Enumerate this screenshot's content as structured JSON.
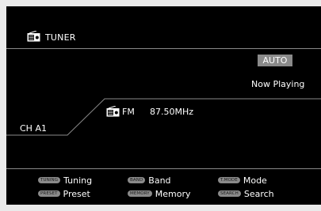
{
  "header": {
    "title": "TUNER",
    "icon": "radio-icon"
  },
  "status": {
    "mode_badge": "AUTO",
    "now_playing": "Now Playing"
  },
  "station": {
    "channel": "CH A1",
    "band": "FM",
    "frequency": "87.50MHz",
    "icon": "radio-icon"
  },
  "legend": [
    {
      "key": "TUNING",
      "label": "Tuning"
    },
    {
      "key": "BAND",
      "label": "Band"
    },
    {
      "key": "T.MODE",
      "label": "Mode"
    },
    {
      "key": "PRESET",
      "label": "Preset"
    },
    {
      "key": "MEMORY",
      "label": "Memory"
    },
    {
      "key": "SEARCH",
      "label": "Search"
    }
  ],
  "colors": {
    "background": "#000000",
    "divider": "#8a8a8a",
    "badge": "#8a8a8a",
    "text": "#ffffff"
  }
}
